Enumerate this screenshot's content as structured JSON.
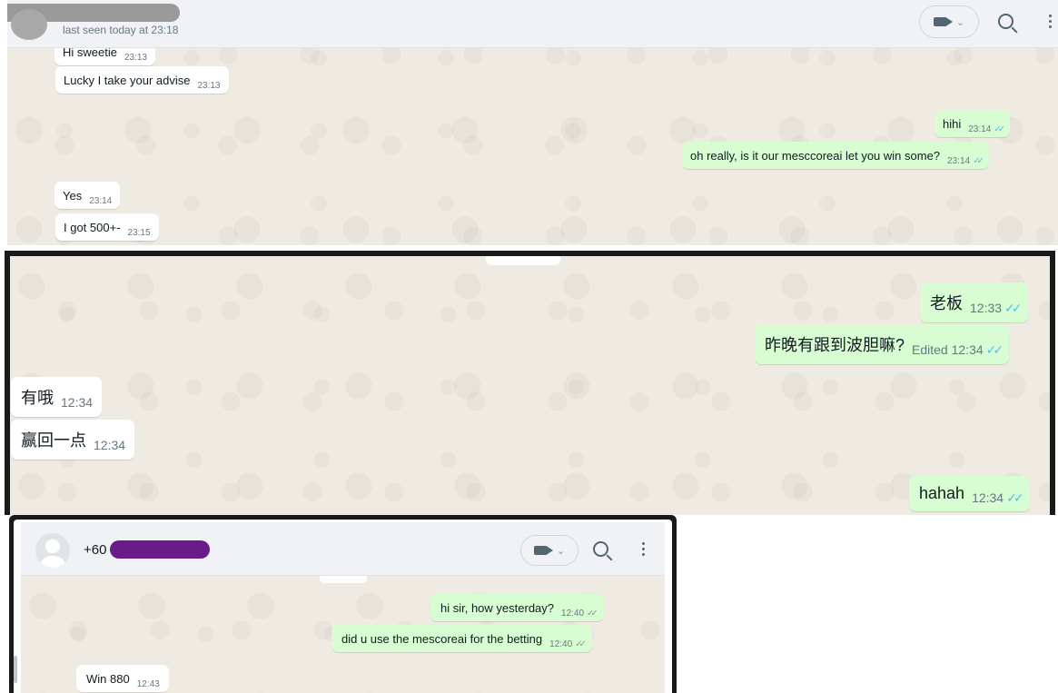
{
  "panel1": {
    "status": "last seen today at 23:18",
    "messages": [
      {
        "text": "Hi sweetie",
        "time": "23:13"
      },
      {
        "text": "Lucky I take your advise",
        "time": "23:13"
      },
      {
        "text": "hihi",
        "time": "23:14"
      },
      {
        "text": "oh really, is it our mesccoreai let you win some?",
        "time": "23:14"
      },
      {
        "text": "Yes",
        "time": "23:14"
      },
      {
        "text": "I got 500+-",
        "time": "23:15"
      }
    ]
  },
  "panel2": {
    "messages": [
      {
        "text": "老板",
        "time": "12:33"
      },
      {
        "text": "昨晚有跟到波胆嘛?",
        "time": "12:34",
        "edited": "Edited"
      },
      {
        "text": "有哦",
        "time": "12:34"
      },
      {
        "text": "赢回一点",
        "time": "12:34"
      },
      {
        "text": "hahah",
        "time": "12:34"
      }
    ]
  },
  "panel3": {
    "contact_prefix": "+60",
    "messages": [
      {
        "text": "hi sir, how yesterday?",
        "time": "12:40"
      },
      {
        "text": "did u use the mescoreai for the betting",
        "time": "12:40"
      },
      {
        "text": "Win 880",
        "time": "12:43"
      }
    ]
  },
  "icons": {
    "video_call": "video-camera-icon",
    "dropdown": "chevron-down-icon",
    "search": "search-icon",
    "menu": "more-vertical-icon",
    "read_receipt": "double-check-icon",
    "avatar": "default-avatar-icon"
  },
  "colors": {
    "chat_background": "#efeae2",
    "incoming_bubble": "#ffffff",
    "outgoing_bubble": "#d9fdd3",
    "read_tick": "#53bdeb",
    "header": "#f0f2f5",
    "frame": "#1a1a1a",
    "redaction_grey": "#9a9a9a",
    "redaction_purple": "#6a1b8a"
  }
}
